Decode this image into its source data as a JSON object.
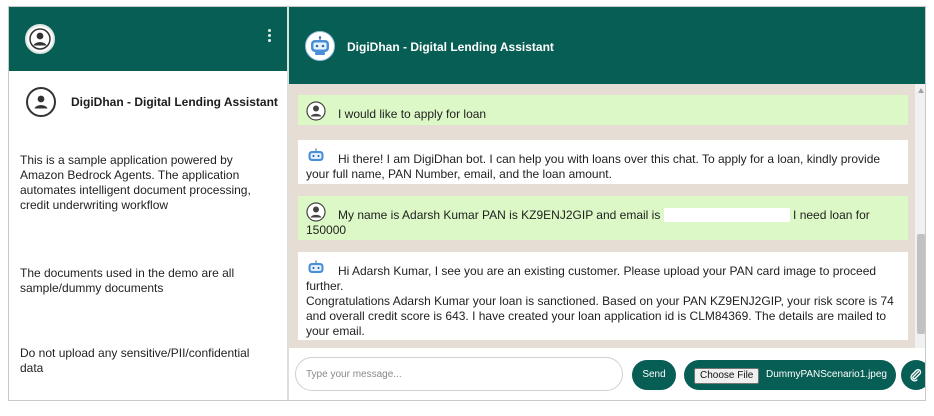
{
  "sidebar": {
    "bot_name": "DigiDhan - Digital Lending Assistant",
    "description": "This is a sample application powered by Amazon Bedrock Agents. The application automates intelligent document processing, credit underwriting workflow",
    "documents_note": "The documents used in the demo are all sample/dummy documents",
    "warning": "Do not upload any sensitive/PII/confidential data"
  },
  "chat": {
    "title": "DigiDhan - Digital Lending Assistant",
    "messages": [
      {
        "sender": "user",
        "text": "I would like to apply for loan"
      },
      {
        "sender": "bot",
        "text": "Hi there! I am DigiDhan bot. I can help you with loans over this chat. To apply for a loan, kindly provide your full name, PAN Number, email, and the loan amount."
      },
      {
        "sender": "user",
        "text_before": "My name is Adarsh Kumar PAN is KZ9ENJ2GIP and email is",
        "text_after": "I need loan for 150000"
      },
      {
        "sender": "bot",
        "text": "Hi Adarsh Kumar, I see you are an existing customer. Please upload your PAN card image to proceed further.",
        "text2": "Congratulations Adarsh Kumar your loan is sanctioned. Based on your PAN KZ9ENJ2GIP, your risk score is 74 and overall credit score is 643. I have created your loan application id is CLM84369. The details are mailed to your email."
      }
    ]
  },
  "input": {
    "placeholder": "Type your message...",
    "send_label": "Send",
    "choose_file_label": "Choose File",
    "file_name": "DummyPANScenario1.jpeg"
  },
  "icons": {
    "user_avatar": "user-avatar-icon",
    "menu": "kebab-menu-icon",
    "bot_logo": "robot-icon",
    "attach": "paperclip-icon"
  },
  "colors": {
    "header": "#075e54",
    "user_bubble": "#dcf8c6",
    "bot_bubble": "#ffffff",
    "chat_background": "#e6ddd4"
  }
}
